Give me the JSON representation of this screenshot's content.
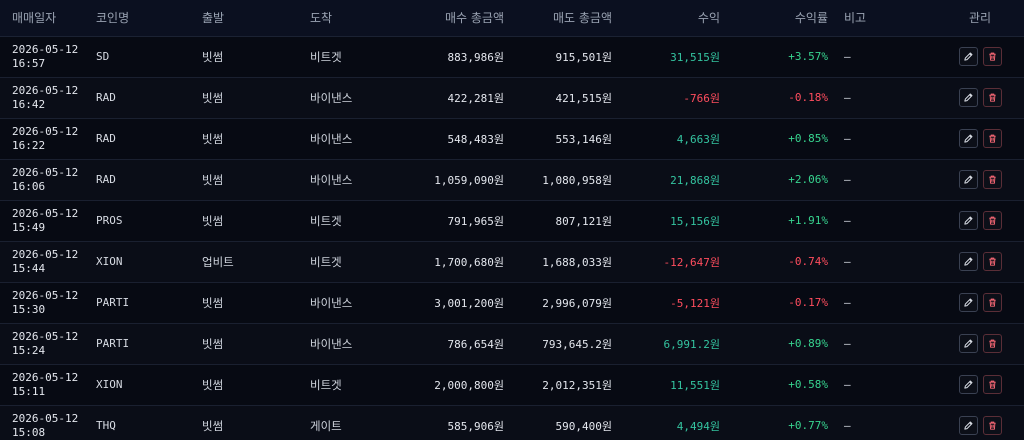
{
  "headers": {
    "date": "매매일자",
    "coin": "코인명",
    "from": "출발",
    "to": "도착",
    "buy": "매수 총금액",
    "sell": "매도 총금액",
    "profit": "수익",
    "rate": "수익률",
    "note": "비고",
    "manage": "관리"
  },
  "rows": [
    {
      "date": "2026-05-12\n16:57",
      "coin": "SD",
      "from": "빗썸",
      "to": "비트겟",
      "buy": "883,986원",
      "sell": "915,501원",
      "profit": "31,515원",
      "rate": "+3.57%",
      "note": "—",
      "sign": "pos"
    },
    {
      "date": "2026-05-12\n16:42",
      "coin": "RAD",
      "from": "빗썸",
      "to": "바이낸스",
      "buy": "422,281원",
      "sell": "421,515원",
      "profit": "-766원",
      "rate": "-0.18%",
      "note": "—",
      "sign": "neg"
    },
    {
      "date": "2026-05-12\n16:22",
      "coin": "RAD",
      "from": "빗썸",
      "to": "바이낸스",
      "buy": "548,483원",
      "sell": "553,146원",
      "profit": "4,663원",
      "rate": "+0.85%",
      "note": "—",
      "sign": "pos"
    },
    {
      "date": "2026-05-12\n16:06",
      "coin": "RAD",
      "from": "빗썸",
      "to": "바이낸스",
      "buy": "1,059,090원",
      "sell": "1,080,958원",
      "profit": "21,868원",
      "rate": "+2.06%",
      "note": "—",
      "sign": "pos"
    },
    {
      "date": "2026-05-12\n15:49",
      "coin": "PROS",
      "from": "빗썸",
      "to": "비트겟",
      "buy": "791,965원",
      "sell": "807,121원",
      "profit": "15,156원",
      "rate": "+1.91%",
      "note": "—",
      "sign": "pos"
    },
    {
      "date": "2026-05-12\n15:44",
      "coin": "XION",
      "from": "업비트",
      "to": "비트겟",
      "buy": "1,700,680원",
      "sell": "1,688,033원",
      "profit": "-12,647원",
      "rate": "-0.74%",
      "note": "—",
      "sign": "neg"
    },
    {
      "date": "2026-05-12\n15:30",
      "coin": "PARTI",
      "from": "빗썸",
      "to": "바이낸스",
      "buy": "3,001,200원",
      "sell": "2,996,079원",
      "profit": "-5,121원",
      "rate": "-0.17%",
      "note": "—",
      "sign": "neg"
    },
    {
      "date": "2026-05-12\n15:24",
      "coin": "PARTI",
      "from": "빗썸",
      "to": "바이낸스",
      "buy": "786,654원",
      "sell": "793,645.2원",
      "profit": "6,991.2원",
      "rate": "+0.89%",
      "note": "—",
      "sign": "pos"
    },
    {
      "date": "2026-05-12\n15:11",
      "coin": "XION",
      "from": "빗썸",
      "to": "비트겟",
      "buy": "2,000,800원",
      "sell": "2,012,351원",
      "profit": "11,551원",
      "rate": "+0.58%",
      "note": "—",
      "sign": "pos"
    },
    {
      "date": "2026-05-12\n15:08",
      "coin": "THQ",
      "from": "빗썸",
      "to": "게이트",
      "buy": "585,906원",
      "sell": "590,400원",
      "profit": "4,494원",
      "rate": "+0.77%",
      "note": "—",
      "sign": "pos"
    }
  ],
  "icons": {
    "edit": "pencil-icon",
    "delete": "trash-icon"
  },
  "colors": {
    "positive": "#34c4a0",
    "negative": "#ff4d5e",
    "background": "#060810"
  }
}
